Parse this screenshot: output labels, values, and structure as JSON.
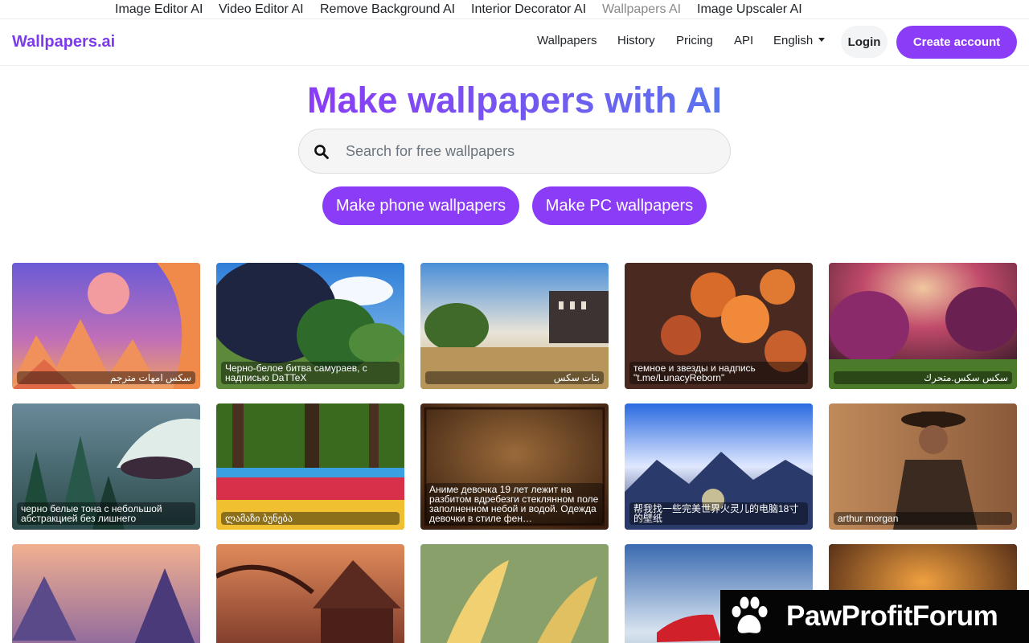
{
  "network_bar": {
    "links": [
      {
        "label": "Image Editor AI"
      },
      {
        "label": "Video Editor AI"
      },
      {
        "label": "Remove Background AI"
      },
      {
        "label": "Interior Decorator AI"
      },
      {
        "label": "Wallpapers AI",
        "active": true
      },
      {
        "label": "Image Upscaler AI"
      }
    ]
  },
  "header": {
    "brand": "Wallpapers.ai",
    "nav": [
      "Wallpapers",
      "History",
      "Pricing",
      "API"
    ],
    "language": "English",
    "login_label": "Login",
    "create_account_label": "Create account",
    "brand_color": "#7c3aed",
    "button_color": "#8b3cf6"
  },
  "hero": {
    "title": "Make wallpapers with AI",
    "search_placeholder": "Search for free wallpapers",
    "search_value": "",
    "phone_button": "Make phone wallpapers",
    "pc_button": "Make PC wallpapers"
  },
  "gallery": {
    "tiles": [
      {
        "caption": "سكس امهات مترجم",
        "rtl": true,
        "icon": "tile-image"
      },
      {
        "caption": "Черно-белое битва самураев, с надписью DaTTeX",
        "rtl": false,
        "icon": "tile-image"
      },
      {
        "caption": "بنات سكس",
        "rtl": true,
        "icon": "tile-image"
      },
      {
        "caption": "темное и звезды и надпись \"t.me/LunacyReborn\"",
        "rtl": false,
        "icon": "tile-image"
      },
      {
        "caption": "سكس سكس.متحرك",
        "rtl": true,
        "icon": "tile-image"
      },
      {
        "caption": "черно белые тона с небольшой абстракцией без лишнего",
        "rtl": false,
        "icon": "tile-image"
      },
      {
        "caption": "ლამაზი ბუნება",
        "rtl": false,
        "icon": "tile-image"
      },
      {
        "caption": "Аниме девочка 19 лет лежит на разбитом вдребезги стеклянном поле заполненном небой и водой. Одежда девочки в стиле фен…",
        "rtl": false,
        "icon": "tile-image"
      },
      {
        "caption": "帮我找一些完美世界火灵儿的电脑18寸的壁纸",
        "rtl": false,
        "icon": "tile-image"
      },
      {
        "caption": "arthur morgan",
        "rtl": false,
        "icon": "tile-image"
      },
      {
        "caption": "",
        "rtl": false,
        "icon": "tile-image"
      },
      {
        "caption": "",
        "rtl": false,
        "icon": "tile-image"
      },
      {
        "caption": "",
        "rtl": false,
        "icon": "tile-image"
      },
      {
        "caption": "",
        "rtl": false,
        "icon": "tile-image"
      },
      {
        "caption": "",
        "rtl": false,
        "icon": "tile-image"
      }
    ]
  },
  "watermark": {
    "text": "PawProfitForum",
    "icon": "paw-icon"
  }
}
